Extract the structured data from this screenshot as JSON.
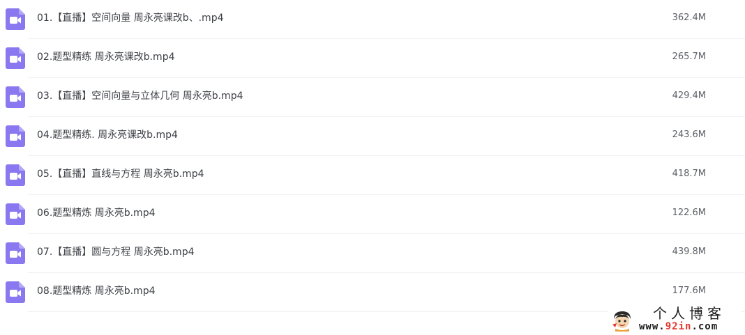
{
  "file_type_icon": "video-file-icon",
  "colors": {
    "icon_purple": "#8a78f0",
    "text": "#3c3f45",
    "size_text": "#5c6066",
    "divider": "#f0f1f3",
    "watermark_accent": "#e5362b"
  },
  "files": [
    {
      "name": "01.【直播】空间向量 周永亮课改b、.mp4",
      "size": "362.4M"
    },
    {
      "name": "02.题型精练 周永亮课改b.mp4",
      "size": "265.7M"
    },
    {
      "name": "03.【直播】空间向量与立体几何 周永亮b.mp4",
      "size": "429.4M"
    },
    {
      "name": "04.题型精练. 周永亮课改b.mp4",
      "size": "243.6M"
    },
    {
      "name": "05.【直播】直线与方程 周永亮b.mp4",
      "size": "418.7M"
    },
    {
      "name": "06.题型精炼 周永亮b.mp4",
      "size": "122.6M"
    },
    {
      "name": "07.【直播】圆与方程 周永亮b.mp4",
      "size": "439.8M"
    },
    {
      "name": "08.题型精炼 周永亮b.mp4",
      "size": "177.6M"
    }
  ],
  "watermark": {
    "title": "个人博客",
    "url_prefix": "www.",
    "url_highlight": "92in",
    "url_suffix": ".com"
  }
}
